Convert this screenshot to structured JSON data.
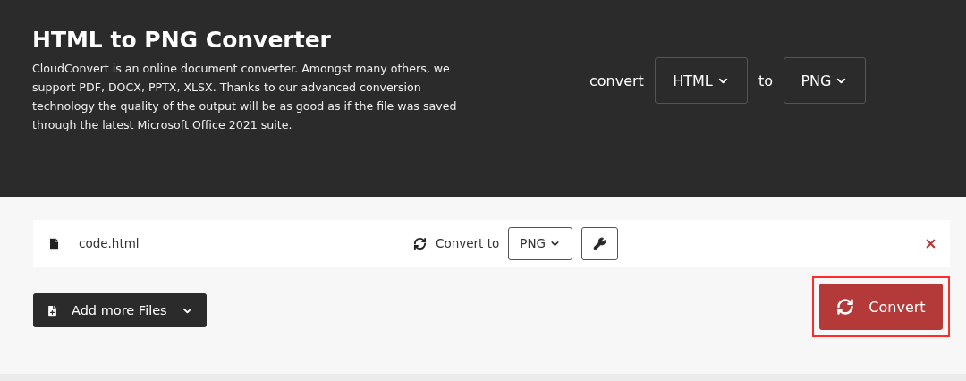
{
  "header": {
    "title": "HTML to PNG Converter",
    "description": "CloudConvert is an online document converter. Amongst many others, we support PDF, DOCX, PPTX, XLSX. Thanks to our advanced conversion technology the quality of the output will be as good as if the file was saved through the latest Microsoft Office 2021 suite.",
    "convert_label": "convert",
    "from_format": "HTML",
    "to_label": "to",
    "to_format": "PNG"
  },
  "files": [
    {
      "name": "code.html",
      "convert_to_label": "Convert to",
      "format": "PNG"
    }
  ],
  "add_files_button": "Add more Files",
  "convert_button": {
    "label": "Convert",
    "highlighted": true
  }
}
